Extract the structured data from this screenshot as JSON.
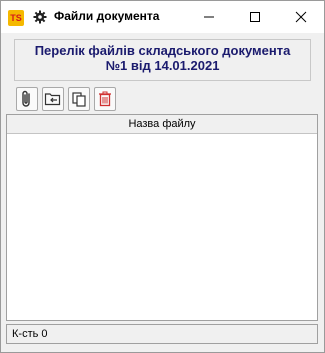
{
  "window": {
    "app_icon_text": "TS",
    "app_icon_name": "ts-app-icon",
    "title_icon_name": "gear-icon",
    "title": "Файли документа",
    "caption_buttons": [
      "minimize",
      "maximize",
      "close"
    ]
  },
  "header": {
    "line1": "Перелік файлів складського документа",
    "line2": "№1 від 14.01.2021",
    "text_color": "#1b1b6e"
  },
  "toolbar": {
    "buttons": [
      {
        "icon": "paperclip-icon"
      },
      {
        "icon": "open-folder-icon"
      },
      {
        "icon": "copy-icon"
      },
      {
        "icon": "trash-icon",
        "color": "#d03030"
      }
    ]
  },
  "grid": {
    "columns": [
      "Назва файлу"
    ],
    "rows": []
  },
  "status": {
    "count_text": "К-сть 0"
  }
}
